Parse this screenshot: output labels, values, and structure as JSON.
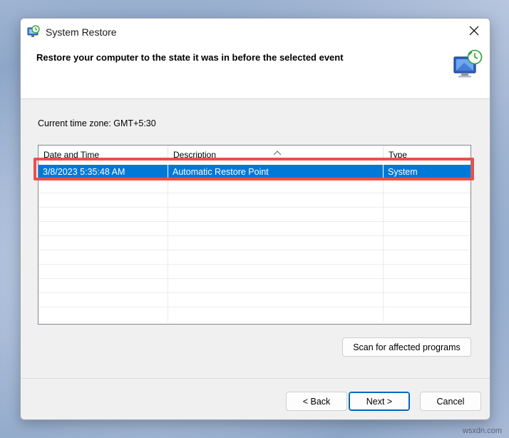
{
  "window": {
    "title": "System Restore",
    "title_icon": "system-restore-icon",
    "close_icon": "close-icon"
  },
  "header": {
    "text": "Restore your computer to the state it was in before the selected event",
    "icon": "system-restore-monitor-icon"
  },
  "timezone_label": "Current time zone: GMT+5:30",
  "table": {
    "columns": [
      "Date and Time",
      "Description",
      "Type"
    ],
    "rows": [
      {
        "date_time": "3/8/2023 5:35:48 AM",
        "description": "Automatic Restore Point",
        "type": "System",
        "selected": true
      }
    ]
  },
  "buttons": {
    "scan": "Scan for affected programs",
    "back": "< Back",
    "next": "Next >",
    "cancel": "Cancel"
  },
  "colors": {
    "selection": "#0078d7",
    "highlight_box": "#e8504a"
  },
  "watermark": "wsxdn.com"
}
